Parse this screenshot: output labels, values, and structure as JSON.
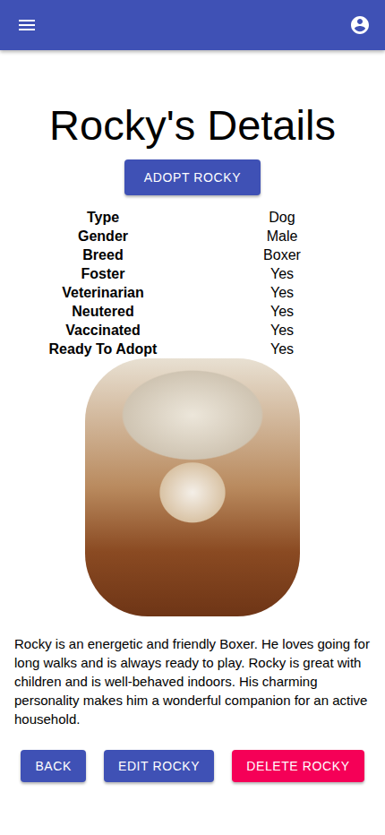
{
  "title": "Rocky's Details",
  "adopt_button": "ADOPT ROCKY",
  "details": [
    {
      "label": "Type",
      "value": "Dog"
    },
    {
      "label": "Gender",
      "value": "Male"
    },
    {
      "label": "Breed",
      "value": "Boxer"
    },
    {
      "label": "Foster",
      "value": "Yes"
    },
    {
      "label": "Veterinarian",
      "value": "Yes"
    },
    {
      "label": "Neutered",
      "value": "Yes"
    },
    {
      "label": "Vaccinated",
      "value": "Yes"
    },
    {
      "label": "Ready To Adopt",
      "value": "Yes"
    }
  ],
  "description": "Rocky is an energetic and friendly Boxer. He loves going for long walks and is always ready to play. Rocky is great with children and is well-behaved indoors. His charming personality makes him a wonderful companion for an active household.",
  "buttons": [
    {
      "label": "BACK",
      "kind": "primary"
    },
    {
      "label": "EDIT ROCKY",
      "kind": "primary"
    },
    {
      "label": "DELETE ROCKY",
      "kind": "danger"
    }
  ]
}
